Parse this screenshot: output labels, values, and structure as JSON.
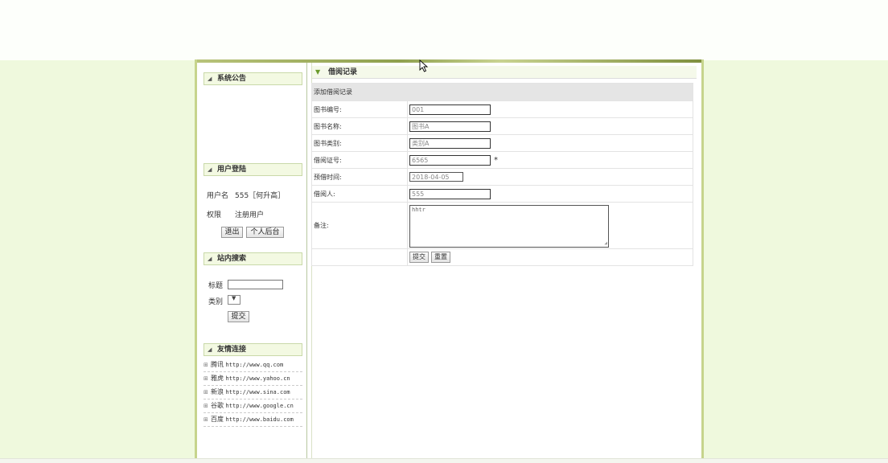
{
  "sidebar": {
    "notice": {
      "title": "系统公告"
    },
    "login": {
      "title": "用户登陆",
      "username_label": "用户名",
      "username_value": "555［何升高］",
      "role_label": "权限",
      "role_value": "注册用户",
      "logout_button": "退出",
      "profile_button": "个人后台"
    },
    "search": {
      "title": "站内搜索",
      "keyword_label": "标题",
      "category_label": "类别",
      "category_value": "",
      "submit_button": "提交"
    },
    "links": {
      "title": "友情连接",
      "items": [
        {
          "name": "腾讯",
          "url": "http://www.qq.com"
        },
        {
          "name": "雅虎",
          "url": "http://www.yahoo.cn"
        },
        {
          "name": "新浪",
          "url": "http://www.sina.com"
        },
        {
          "name": "谷歌",
          "url": "http://www.google.cn"
        },
        {
          "name": "百度",
          "url": "http://www.baidu.com"
        }
      ]
    }
  },
  "main": {
    "header": "借阅记录",
    "form": {
      "title": "添加借阅记录",
      "book_id": {
        "label": "图书编号:",
        "value": "001"
      },
      "book_name": {
        "label": "图书名称:",
        "value": "图书A"
      },
      "book_category": {
        "label": "图书类别:",
        "value": "类别A"
      },
      "card_no": {
        "label": "借阅证号:",
        "value": "6565",
        "required_mark": "*"
      },
      "borrow_date": {
        "label": "预借时间:",
        "value": "2018-04-05"
      },
      "borrower": {
        "label": "借阅人:",
        "value": "555"
      },
      "remark": {
        "label": "备注:",
        "value": "hhtr"
      },
      "submit_button": "提交",
      "reset_button": "重置"
    }
  }
}
